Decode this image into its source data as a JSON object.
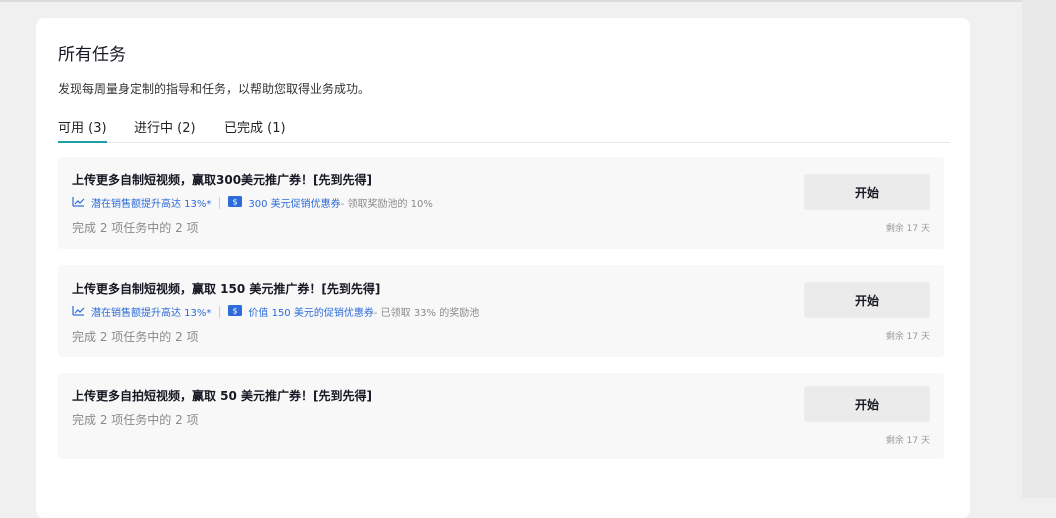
{
  "header": {
    "title": "所有任务",
    "subtitle": "发现每周量身定制的指导和任务，以帮助您取得业务成功。"
  },
  "tabs": [
    {
      "label": "可用 (3)",
      "active": true
    },
    {
      "label": "进行中 (2)",
      "active": false
    },
    {
      "label": "已完成 (1)",
      "active": false
    }
  ],
  "tasks": [
    {
      "title": "上传更多自制短视频，赢取300美元推广券！[先到先得]",
      "metric": "潜在销售额提升高达 13%*",
      "coupon": "300 美元促销优惠券",
      "coupon_note": " - 领取奖励池的 10%",
      "progress": "完成 2 项任务中的 2 项",
      "button": "开始",
      "remaining": "剩余 17 天"
    },
    {
      "title": "上传更多自制短视频，赢取 150 美元推广券！[先到先得]",
      "metric": "潜在销售额提升高达 13%*",
      "coupon": "价值 150 美元的促销优惠券",
      "coupon_note": " - 已领取 33% 的奖励池",
      "progress": "完成 2 项任务中的 2 项",
      "button": "开始",
      "remaining": "剩余 17 天"
    },
    {
      "title": "上传更多自拍短视频，赢取 50 美元推广券！[先到先得]",
      "progress": "完成 2 项任务中的 2 项",
      "button": "开始",
      "remaining": "剩余 17 天"
    }
  ],
  "colors": {
    "accent": "#1f9ea3",
    "link": "#2c6bd9",
    "card_bg": "#f8f8f8",
    "button_bg": "#ebebeb"
  }
}
